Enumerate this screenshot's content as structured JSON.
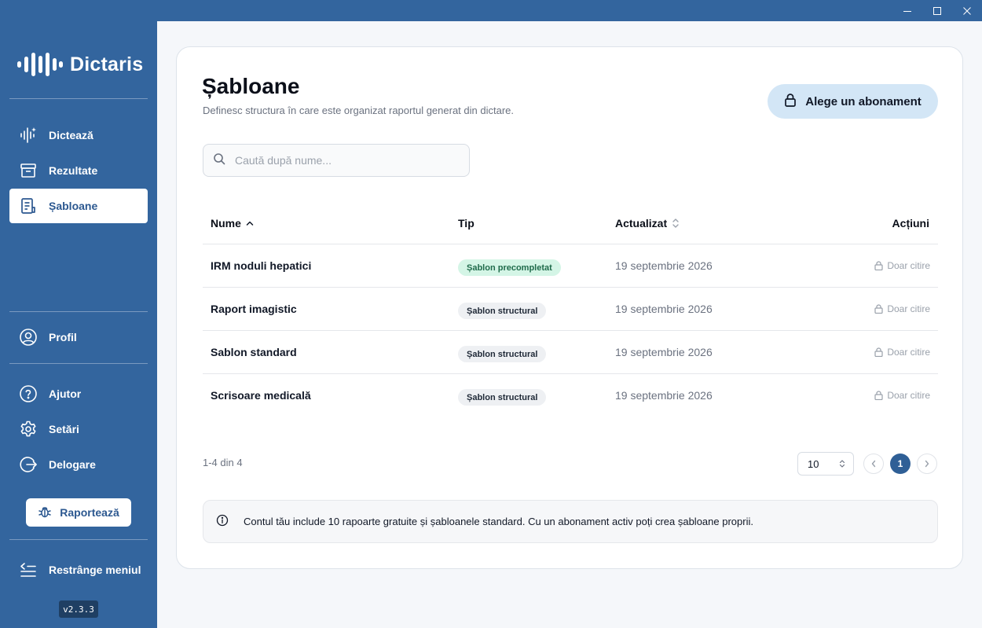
{
  "window": {
    "controls": [
      "minimize",
      "maximize",
      "close"
    ]
  },
  "sidebar": {
    "brand": "Dictaris",
    "items": [
      {
        "label": "Dictează",
        "icon": "waveform-sparkle-icon"
      },
      {
        "label": "Rezultate",
        "icon": "archive-box-icon"
      },
      {
        "label": "Șabloane",
        "icon": "template-document-icon",
        "active": true
      },
      {
        "label": "Profil",
        "icon": "user-circle-icon"
      },
      {
        "label": "Ajutor",
        "icon": "help-circle-icon"
      },
      {
        "label": "Setări",
        "icon": "gear-icon"
      },
      {
        "label": "Delogare",
        "icon": "logout-icon"
      }
    ],
    "report_button": "Raportează",
    "collapse_label": "Restrânge meniul",
    "version": "v2.3.3"
  },
  "header": {
    "title": "Șabloane",
    "subtitle": "Definesc structura în care este organizat raportul generat din dictare.",
    "subscribe_button": "Alege un abonament"
  },
  "search": {
    "placeholder": "Caută după nume..."
  },
  "table": {
    "columns": [
      "Nume",
      "Tip",
      "Actualizat",
      "Acțiuni"
    ],
    "rows": [
      {
        "name": "IRM noduli hepatici",
        "type": "Șablon precompletat",
        "type_kind": "prefilled",
        "updated": "19 septembrie 2026",
        "action": "Doar citire"
      },
      {
        "name": "Raport imagistic",
        "type": "Șablon structural",
        "type_kind": "structural",
        "updated": "19 septembrie 2026",
        "action": "Doar citire"
      },
      {
        "name": "Sablon standard",
        "type": "Șablon structural",
        "type_kind": "structural",
        "updated": "19 septembrie 2026",
        "action": "Doar citire"
      },
      {
        "name": "Scrisoare medicală",
        "type": "Șablon structural",
        "type_kind": "structural",
        "updated": "19 septembrie 2026",
        "action": "Doar citire"
      }
    ]
  },
  "pagination": {
    "summary": "1-4 din 4",
    "page_size": "10",
    "current_page": "1"
  },
  "info_banner": {
    "text": "Contul tău include 10 rapoarte gratuite și șabloanele standard. Cu un abonament activ poți crea șabloane proprii."
  },
  "colors": {
    "sidebar_bg": "#33659e",
    "accent": "#2f5f96",
    "subscribe_bg": "#d3e6f6",
    "badge_prefilled_bg": "#d4f5e6",
    "badge_structural_bg": "#eef0f3"
  }
}
